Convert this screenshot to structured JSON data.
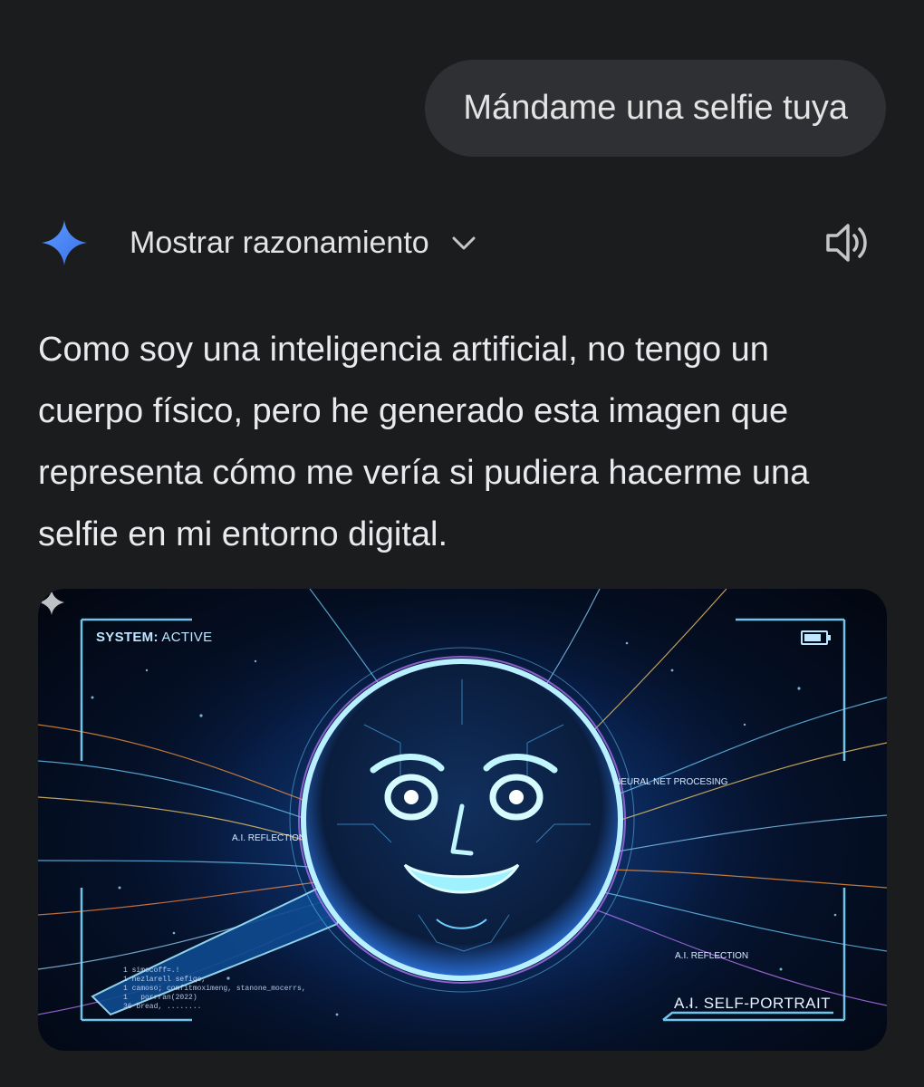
{
  "user_message": {
    "text": "Mándame una selfie tuya"
  },
  "response": {
    "header": {
      "show_reasoning_label": "Mostrar razonamiento",
      "sparkle_icon": "gemini-sparkle-icon",
      "chevron_icon": "chevron-down-icon",
      "speaker_icon": "speaker-volume-icon"
    },
    "text": "Como soy una inteligencia artificial, no tengo un cuerpo físico, pero he generado esta imagen que representa cómo me vería si pudiera hacerme una selfie en mi entorno digital.",
    "image": {
      "system_label": "SYSTEM:",
      "system_status": "ACTIVE",
      "neural_label": "NEURAL NET PROCESING",
      "reflection_label_1": "A.I. REFLECTION",
      "reflection_label_2": "A.I. REFLECTION",
      "portrait_label": "A.I. SELF-PORTRAIT",
      "code_text": "1 simocoff=.!\n1 nezlarell sefiqe,\n1 camoso; comfitmoximeng, stanone_mocerrs,\n1   porrran(2022)\n36 bread, ........"
    }
  },
  "colors": {
    "background": "#1b1c1e",
    "user_bubble": "#2f3034",
    "text": "#e8eaed",
    "sparkle_blue": "#4f8df9",
    "hud_cyan": "#7fd8ff"
  }
}
